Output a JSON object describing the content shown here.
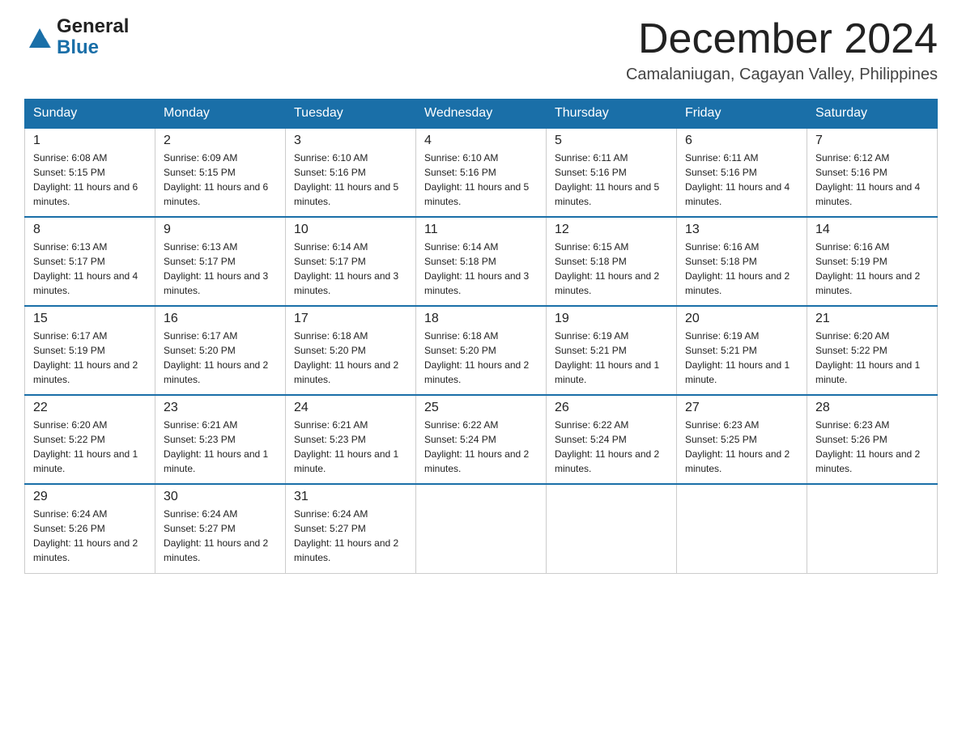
{
  "header": {
    "logo_general": "General",
    "logo_blue": "Blue",
    "month_title": "December 2024",
    "location": "Camalaniugan, Cagayan Valley, Philippines"
  },
  "weekdays": [
    "Sunday",
    "Monday",
    "Tuesday",
    "Wednesday",
    "Thursday",
    "Friday",
    "Saturday"
  ],
  "weeks": [
    [
      {
        "day": "1",
        "sunrise": "Sunrise: 6:08 AM",
        "sunset": "Sunset: 5:15 PM",
        "daylight": "Daylight: 11 hours and 6 minutes."
      },
      {
        "day": "2",
        "sunrise": "Sunrise: 6:09 AM",
        "sunset": "Sunset: 5:15 PM",
        "daylight": "Daylight: 11 hours and 6 minutes."
      },
      {
        "day": "3",
        "sunrise": "Sunrise: 6:10 AM",
        "sunset": "Sunset: 5:16 PM",
        "daylight": "Daylight: 11 hours and 5 minutes."
      },
      {
        "day": "4",
        "sunrise": "Sunrise: 6:10 AM",
        "sunset": "Sunset: 5:16 PM",
        "daylight": "Daylight: 11 hours and 5 minutes."
      },
      {
        "day": "5",
        "sunrise": "Sunrise: 6:11 AM",
        "sunset": "Sunset: 5:16 PM",
        "daylight": "Daylight: 11 hours and 5 minutes."
      },
      {
        "day": "6",
        "sunrise": "Sunrise: 6:11 AM",
        "sunset": "Sunset: 5:16 PM",
        "daylight": "Daylight: 11 hours and 4 minutes."
      },
      {
        "day": "7",
        "sunrise": "Sunrise: 6:12 AM",
        "sunset": "Sunset: 5:16 PM",
        "daylight": "Daylight: 11 hours and 4 minutes."
      }
    ],
    [
      {
        "day": "8",
        "sunrise": "Sunrise: 6:13 AM",
        "sunset": "Sunset: 5:17 PM",
        "daylight": "Daylight: 11 hours and 4 minutes."
      },
      {
        "day": "9",
        "sunrise": "Sunrise: 6:13 AM",
        "sunset": "Sunset: 5:17 PM",
        "daylight": "Daylight: 11 hours and 3 minutes."
      },
      {
        "day": "10",
        "sunrise": "Sunrise: 6:14 AM",
        "sunset": "Sunset: 5:17 PM",
        "daylight": "Daylight: 11 hours and 3 minutes."
      },
      {
        "day": "11",
        "sunrise": "Sunrise: 6:14 AM",
        "sunset": "Sunset: 5:18 PM",
        "daylight": "Daylight: 11 hours and 3 minutes."
      },
      {
        "day": "12",
        "sunrise": "Sunrise: 6:15 AM",
        "sunset": "Sunset: 5:18 PM",
        "daylight": "Daylight: 11 hours and 2 minutes."
      },
      {
        "day": "13",
        "sunrise": "Sunrise: 6:16 AM",
        "sunset": "Sunset: 5:18 PM",
        "daylight": "Daylight: 11 hours and 2 minutes."
      },
      {
        "day": "14",
        "sunrise": "Sunrise: 6:16 AM",
        "sunset": "Sunset: 5:19 PM",
        "daylight": "Daylight: 11 hours and 2 minutes."
      }
    ],
    [
      {
        "day": "15",
        "sunrise": "Sunrise: 6:17 AM",
        "sunset": "Sunset: 5:19 PM",
        "daylight": "Daylight: 11 hours and 2 minutes."
      },
      {
        "day": "16",
        "sunrise": "Sunrise: 6:17 AM",
        "sunset": "Sunset: 5:20 PM",
        "daylight": "Daylight: 11 hours and 2 minutes."
      },
      {
        "day": "17",
        "sunrise": "Sunrise: 6:18 AM",
        "sunset": "Sunset: 5:20 PM",
        "daylight": "Daylight: 11 hours and 2 minutes."
      },
      {
        "day": "18",
        "sunrise": "Sunrise: 6:18 AM",
        "sunset": "Sunset: 5:20 PM",
        "daylight": "Daylight: 11 hours and 2 minutes."
      },
      {
        "day": "19",
        "sunrise": "Sunrise: 6:19 AM",
        "sunset": "Sunset: 5:21 PM",
        "daylight": "Daylight: 11 hours and 1 minute."
      },
      {
        "day": "20",
        "sunrise": "Sunrise: 6:19 AM",
        "sunset": "Sunset: 5:21 PM",
        "daylight": "Daylight: 11 hours and 1 minute."
      },
      {
        "day": "21",
        "sunrise": "Sunrise: 6:20 AM",
        "sunset": "Sunset: 5:22 PM",
        "daylight": "Daylight: 11 hours and 1 minute."
      }
    ],
    [
      {
        "day": "22",
        "sunrise": "Sunrise: 6:20 AM",
        "sunset": "Sunset: 5:22 PM",
        "daylight": "Daylight: 11 hours and 1 minute."
      },
      {
        "day": "23",
        "sunrise": "Sunrise: 6:21 AM",
        "sunset": "Sunset: 5:23 PM",
        "daylight": "Daylight: 11 hours and 1 minute."
      },
      {
        "day": "24",
        "sunrise": "Sunrise: 6:21 AM",
        "sunset": "Sunset: 5:23 PM",
        "daylight": "Daylight: 11 hours and 1 minute."
      },
      {
        "day": "25",
        "sunrise": "Sunrise: 6:22 AM",
        "sunset": "Sunset: 5:24 PM",
        "daylight": "Daylight: 11 hours and 2 minutes."
      },
      {
        "day": "26",
        "sunrise": "Sunrise: 6:22 AM",
        "sunset": "Sunset: 5:24 PM",
        "daylight": "Daylight: 11 hours and 2 minutes."
      },
      {
        "day": "27",
        "sunrise": "Sunrise: 6:23 AM",
        "sunset": "Sunset: 5:25 PM",
        "daylight": "Daylight: 11 hours and 2 minutes."
      },
      {
        "day": "28",
        "sunrise": "Sunrise: 6:23 AM",
        "sunset": "Sunset: 5:26 PM",
        "daylight": "Daylight: 11 hours and 2 minutes."
      }
    ],
    [
      {
        "day": "29",
        "sunrise": "Sunrise: 6:24 AM",
        "sunset": "Sunset: 5:26 PM",
        "daylight": "Daylight: 11 hours and 2 minutes."
      },
      {
        "day": "30",
        "sunrise": "Sunrise: 6:24 AM",
        "sunset": "Sunset: 5:27 PM",
        "daylight": "Daylight: 11 hours and 2 minutes."
      },
      {
        "day": "31",
        "sunrise": "Sunrise: 6:24 AM",
        "sunset": "Sunset: 5:27 PM",
        "daylight": "Daylight: 11 hours and 2 minutes."
      },
      null,
      null,
      null,
      null
    ]
  ]
}
